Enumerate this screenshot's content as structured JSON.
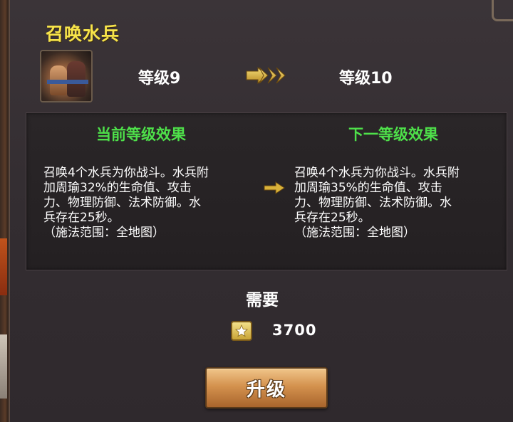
{
  "skill": {
    "name": "召唤水兵",
    "icon": "water-soldier-skill-icon"
  },
  "level": {
    "current": "等级9",
    "next": "等级10"
  },
  "effects": {
    "current_title": "当前等级效果",
    "next_title": "下一等级效果",
    "current_text": "召唤4个水兵为你战斗。水兵附\n加周瑜32%的生命值、攻击\n力、物理防御、法术防御。水\n兵存在25秒。\n（施法范围：全地图）",
    "next_text": "召唤4个水兵为你战斗。水兵附\n加周瑜35%的生命值、攻击\n力、物理防御、法术防御。水\n兵存在25秒。\n（施法范围：全地图）"
  },
  "requirement": {
    "label": "需要",
    "cost_icon": "star-currency-icon",
    "cost_value": "3700"
  },
  "actions": {
    "upgrade_label": "升级"
  },
  "colors": {
    "title": "#f7e44a",
    "effect_title": "#4ee04a",
    "button": "#d4924e",
    "arrow": "#d9b23a"
  }
}
